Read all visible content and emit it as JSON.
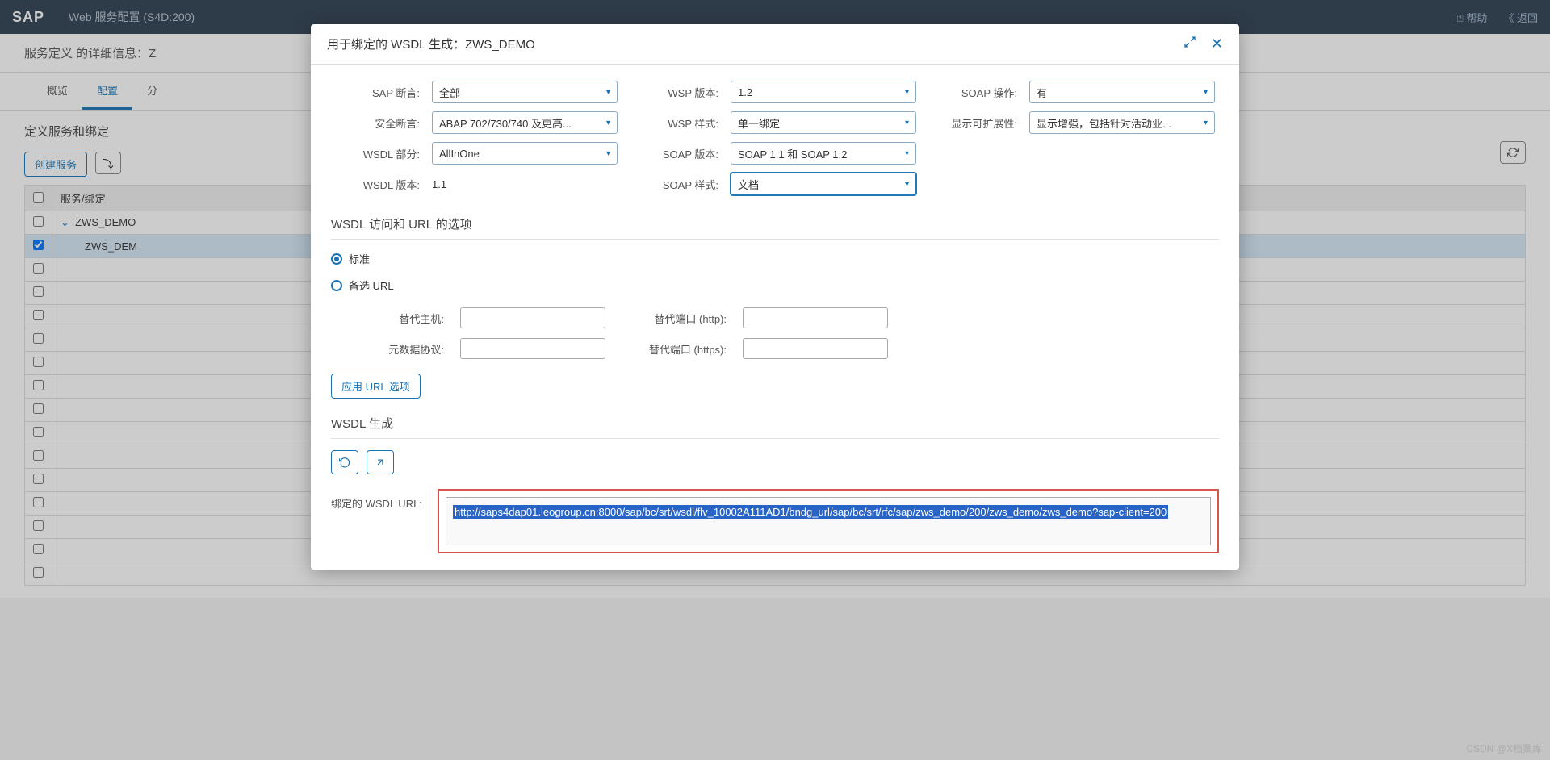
{
  "header": {
    "logo": "SAP",
    "title": "Web 服务配置 (S4D:200)",
    "help": "帮助",
    "back": "返回"
  },
  "subheader": {
    "title": "服务定义 的详细信息：Z"
  },
  "tabs": {
    "overview": "概览",
    "config": "配置",
    "assign": "分"
  },
  "bindingSection": {
    "title": "定义服务和绑定",
    "createBtn": "创建服务"
  },
  "tableHeader": {
    "col1": "服务/绑定"
  },
  "tableRows": {
    "row0": "ZWS_DEMO",
    "row1": "ZWS_DEM"
  },
  "modal": {
    "title": "用于绑定的 WSDL 生成：ZWS_DEMO",
    "labels": {
      "sapAssert": "SAP 断言:",
      "secAssert": "安全断言:",
      "wsdlPart": "WSDL 部分:",
      "wsdlVer": "WSDL 版本:",
      "wspVer": "WSP 版本:",
      "wspStyle": "WSP 样式:",
      "soapVer": "SOAP 版本:",
      "soapStyle": "SOAP 样式:",
      "soapOp": "SOAP 操作:",
      "showExt": "显示可扩展性:"
    },
    "values": {
      "sapAssert": "全部",
      "secAssert": "ABAP 702/730/740 及更高...",
      "wsdlPart": "AllInOne",
      "wsdlVer": "1.1",
      "wspVer": "1.2",
      "wspStyle": "单一绑定",
      "soapVer": "SOAP 1.1 和 SOAP 1.2",
      "soapStyle": "文档",
      "soapOp": "有",
      "showExt": "显示增强，包括针对活动业..."
    },
    "section2": "WSDL 访问和 URL 的选项",
    "radio": {
      "standard": "标准",
      "alternate": "备选 URL"
    },
    "urlForm": {
      "altHost": "替代主机:",
      "metaProto": "元数据协议:",
      "altPortHttp": "替代端口 (http):",
      "altPortHttps": "替代端口 (https):"
    },
    "applyBtn": "应用 URL 选项",
    "section3": "WSDL 生成",
    "resultLabel": "绑定的 WSDL URL:",
    "resultUrl": "http://saps4dap01.leogroup.cn:8000/sap/bc/srt/wsdl/flv_10002A111AD1/bndg_url/sap/bc/srt/rfc/sap/zws_demo/200/zws_demo/zws_demo?sap-client=200"
  },
  "watermark": "CSDN @X档案库"
}
